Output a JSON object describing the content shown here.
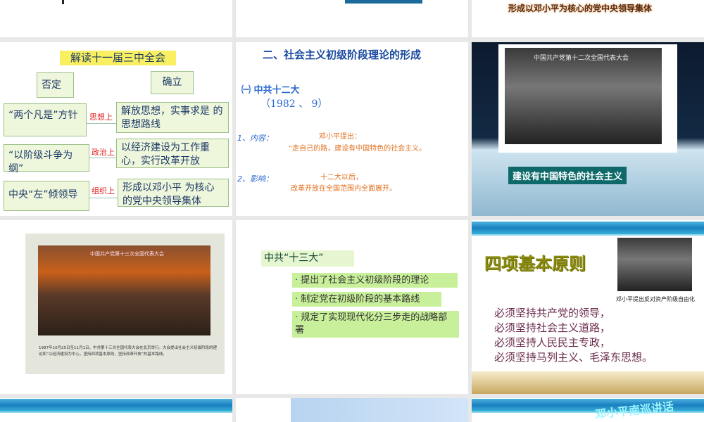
{
  "row1": {
    "slide3_caption": "形成以邓小平为核心的党中央领导集体"
  },
  "slide_jiedu": {
    "title": "解读十一届三中全会",
    "deny": "否定",
    "establish": "确立",
    "rows": [
      {
        "left": "“两个凡是”方针",
        "label": "思想上",
        "right": "解放思想，实事求是 的思想路线"
      },
      {
        "left": "“以阶级斗争为纲”",
        "label": "政治上",
        "right": "以经济建设为工作重心，实行改革开放"
      },
      {
        "left": "中央“左”倾领导",
        "label": "组织上",
        "right": "形成以邓小平 为核心的党中央领导集体"
      }
    ]
  },
  "slide_theory": {
    "title": "二、社会主义初级阶段理论的形成",
    "sub": "㈠ 中共十二大",
    "date": "（1982 、 9）",
    "item1_label": "1、内容：",
    "item1_a": "邓小平提出：",
    "item1_b": "“走自己的路，建设有中国特色的社会主义。",
    "item2_label": "2、影响：",
    "item2_a": "十二大以后，",
    "item2_b": "改革开放在全国范围内全面展开。"
  },
  "slide_12th": {
    "photo_banner": "中国共产党第十二次全国代表大会",
    "caption": "建设有中国特色的社会主义"
  },
  "slide_13th_photo": {
    "banner": "中国共产党第十三次全国代表大会",
    "caption": "1987年10月25日至11月1日，中共第十三次全国代表大会在北京举行。大会提出社会主义初级阶段的理论和“以经济建设为中心，坚持四项基本原则，坚持改革开放”的基本路线。"
  },
  "slide_13th": {
    "title": "中共“十三大”",
    "points": [
      "· 提出了社会主义初级阶段的理论",
      "· 制定党在初级阶段的基本路线",
      "· 规定了实现现代化分三步走的战略部署"
    ]
  },
  "slide_four": {
    "title": "四项基本原则",
    "photo_caption": "邓小平提出反对资产阶级自由化",
    "lines": [
      "必须坚持共产党的领导，",
      "必须坚持社会主义道路，",
      "必须坚持人民民主专政，",
      "必须坚持马列主义、毛泽东思想。"
    ]
  },
  "row4": {
    "southern_tour": "邓小平南巡讲话"
  }
}
